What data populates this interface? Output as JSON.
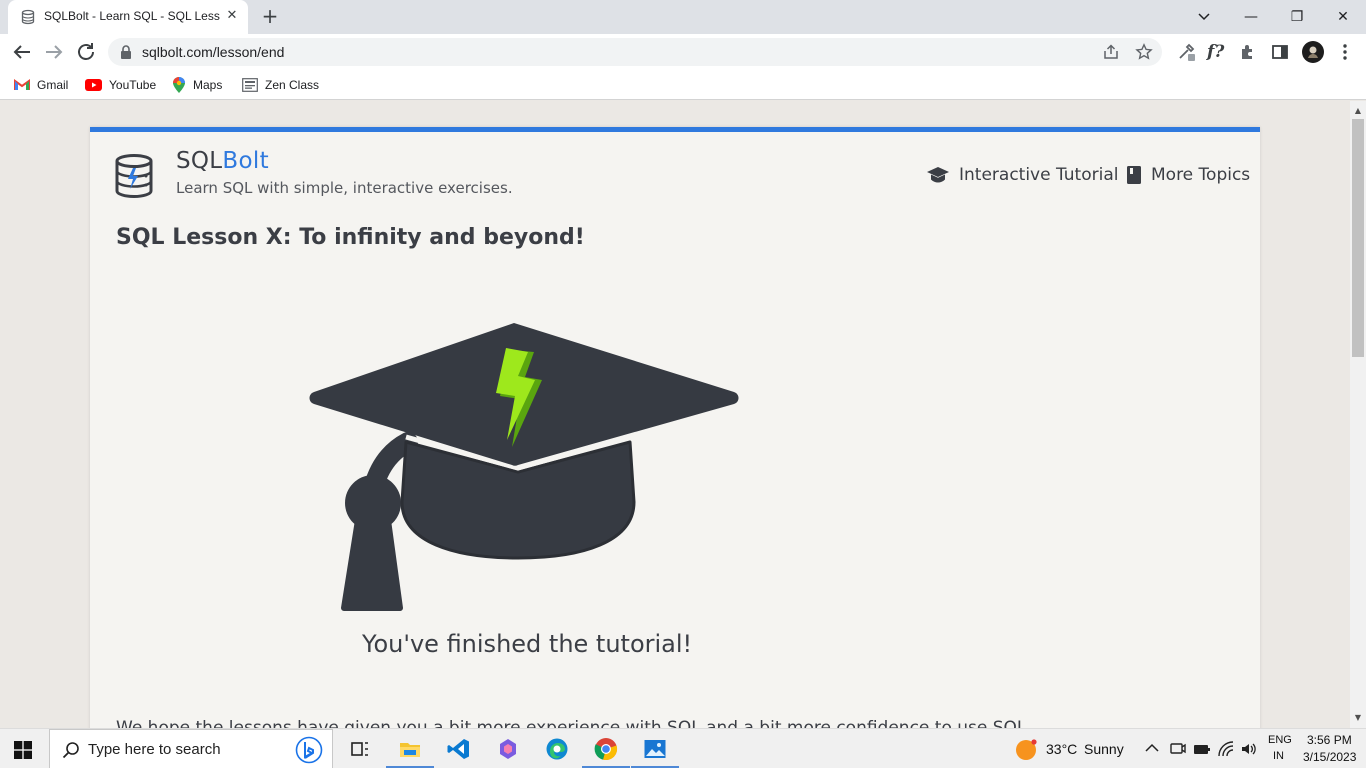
{
  "browser": {
    "tab_title": "SQLBolt - Learn SQL - SQL Lesson",
    "tab_close": "✕",
    "new_tab": "+",
    "url": "sqlbolt.com/lesson/end",
    "window_controls": {
      "minimize": "—",
      "restore": "❐",
      "close": "✕"
    }
  },
  "bookmarks": [
    {
      "label": "Gmail",
      "icon": "gmail-icon"
    },
    {
      "label": "YouTube",
      "icon": "youtube-icon"
    },
    {
      "label": "Maps",
      "icon": "maps-icon"
    },
    {
      "label": "Zen Class",
      "icon": "zen-class-icon"
    }
  ],
  "site": {
    "brand_prefix": "SQL",
    "brand_suffix": "Bolt",
    "tagline": "Learn SQL with simple, interactive exercises.",
    "nav": [
      {
        "label": "Interactive Tutorial",
        "icon": "graduation-cap-icon"
      },
      {
        "label": "More Topics",
        "icon": "book-icon"
      }
    ],
    "accent_color": "#2f79de"
  },
  "lesson": {
    "title": "SQL Lesson X: To infinity and beyond!",
    "finished_text": "You've finished the tutorial!",
    "body_intro": "We hope the lessons have given you a bit more experience with SQL and a bit more confidence to use SQL"
  },
  "taskbar": {
    "search_placeholder": "Type here to search",
    "weather_temp": "33°C",
    "weather_cond": "Sunny",
    "lang_top": "ENG",
    "lang_bottom": "IN",
    "time": "3:56 PM",
    "date": "3/15/2023"
  }
}
